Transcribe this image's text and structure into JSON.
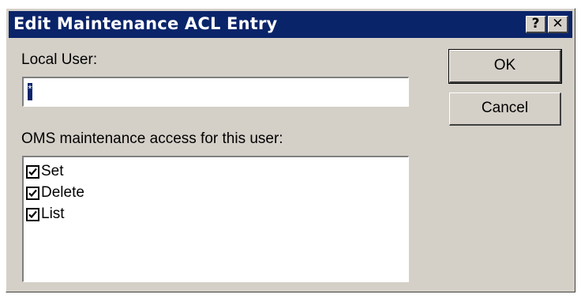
{
  "window": {
    "title": "Edit Maintenance ACL Entry",
    "help_glyph": "?",
    "close_glyph": "✕"
  },
  "local_user": {
    "label": "Local User:",
    "value": "*"
  },
  "access": {
    "label": "OMS maintenance access for this user:",
    "items": [
      {
        "label": "Set",
        "checked": true
      },
      {
        "label": "Delete",
        "checked": true
      },
      {
        "label": "List",
        "checked": true
      }
    ]
  },
  "buttons": {
    "ok": "OK",
    "cancel": "Cancel"
  },
  "colors": {
    "titlebar": "#0a246a",
    "face": "#d4d0c8"
  }
}
